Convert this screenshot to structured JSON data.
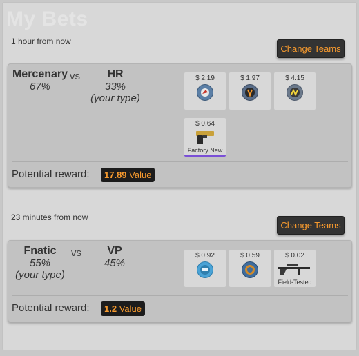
{
  "page": {
    "title": "My Bets"
  },
  "bets": [
    {
      "time": "1 hour from now",
      "change_button": "Change Teams",
      "team1": {
        "name": "Mercenary",
        "percent": "67%"
      },
      "vs": "vs",
      "team2": {
        "name": "HR",
        "percent": "33%",
        "note": "(your type)"
      },
      "items": [
        {
          "price": "$ 2.19",
          "icon": "red-team-sticker-icon"
        },
        {
          "price": "$ 1.97",
          "icon": "fnatic-sticker-icon"
        },
        {
          "price": "$ 4.15",
          "icon": "navi-sticker-icon"
        },
        {
          "price": "$ 0.64",
          "icon": "gold-pistol-icon",
          "condition": "Factory New"
        }
      ],
      "reward_label": "Potential reward:",
      "reward_value": "17.89",
      "reward_unit": "Value"
    },
    {
      "time": "23 minutes from now",
      "change_button": "Change Teams",
      "team1": {
        "name": "Fnatic",
        "percent": "55%",
        "note": "(your type)"
      },
      "vs": "vs",
      "team2": {
        "name": "VP",
        "percent": "45%"
      },
      "items": [
        {
          "price": "$ 0.92",
          "icon": "one-sticker-icon"
        },
        {
          "price": "$ 0.59",
          "icon": "esl-sticker-icon"
        },
        {
          "price": "$ 0.02",
          "icon": "sniper-rifle-icon",
          "condition": "Field-Tested"
        }
      ],
      "reward_label": "Potential reward:",
      "reward_value": "1.2",
      "reward_unit": "Value"
    }
  ],
  "colors": {
    "accent": "#f79a2e",
    "button_bg": "#333333",
    "card_bg": "#c2c2c2"
  }
}
